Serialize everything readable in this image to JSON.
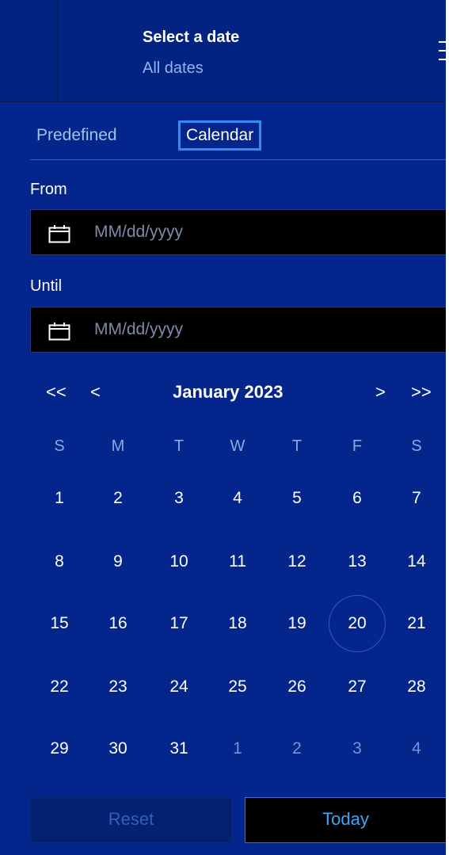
{
  "header": {
    "title": "Select a date",
    "subtitle": "All dates"
  },
  "tabs": [
    {
      "label": "Predefined",
      "selected": false
    },
    {
      "label": "Calendar",
      "selected": true
    }
  ],
  "from": {
    "label": "From",
    "placeholder": "MM/dd/yyyy",
    "value": ""
  },
  "until": {
    "label": "Until",
    "placeholder": "MM/dd/yyyy",
    "value": ""
  },
  "calendar": {
    "month_label": "January 2023",
    "prev_year": "<<",
    "prev_month": "<",
    "next_month": ">",
    "next_year": ">>",
    "weekdays": [
      "S",
      "M",
      "T",
      "W",
      "T",
      "F",
      "S"
    ],
    "weeks": [
      [
        {
          "d": "1"
        },
        {
          "d": "2"
        },
        {
          "d": "3"
        },
        {
          "d": "4"
        },
        {
          "d": "5"
        },
        {
          "d": "6"
        },
        {
          "d": "7"
        }
      ],
      [
        {
          "d": "8"
        },
        {
          "d": "9"
        },
        {
          "d": "10"
        },
        {
          "d": "11"
        },
        {
          "d": "12"
        },
        {
          "d": "13"
        },
        {
          "d": "14"
        }
      ],
      [
        {
          "d": "15"
        },
        {
          "d": "16"
        },
        {
          "d": "17"
        },
        {
          "d": "18"
        },
        {
          "d": "19"
        },
        {
          "d": "20",
          "today": true
        },
        {
          "d": "21"
        }
      ],
      [
        {
          "d": "22"
        },
        {
          "d": "23"
        },
        {
          "d": "24"
        },
        {
          "d": "25"
        },
        {
          "d": "26"
        },
        {
          "d": "27"
        },
        {
          "d": "28"
        }
      ],
      [
        {
          "d": "29"
        },
        {
          "d": "30"
        },
        {
          "d": "31"
        },
        {
          "d": "1",
          "muted": true
        },
        {
          "d": "2",
          "muted": true
        },
        {
          "d": "3",
          "muted": true
        },
        {
          "d": "4",
          "muted": true
        }
      ]
    ]
  },
  "buttons": {
    "reset": "Reset",
    "today": "Today"
  }
}
